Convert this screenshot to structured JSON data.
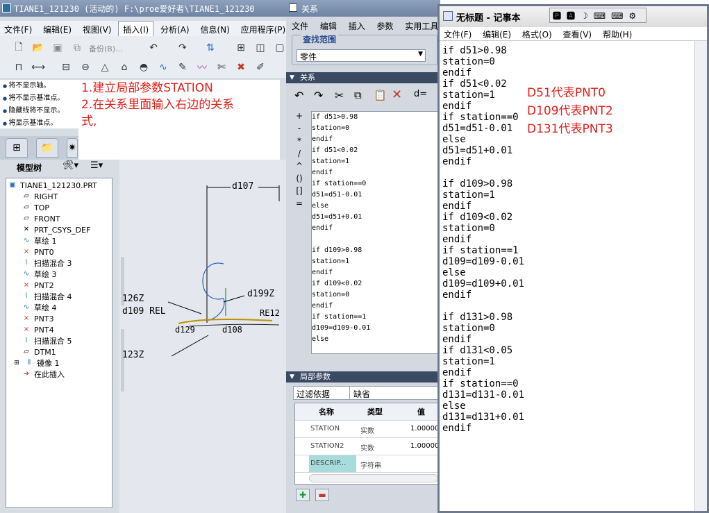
{
  "proe": {
    "title": "TIANE1_121230 (活动的) F:\\proe爱好者\\TIANE1_121230",
    "menu": [
      "文件(F)",
      "编辑(E)",
      "视图(V)",
      "插入(I)",
      "分析(A)",
      "信息(N)",
      "应用程序(P)"
    ],
    "toolbar_backup_label": "备份(B)...",
    "status_lines": [
      "将不显示轴。",
      "将不显示基准点。",
      "隐藏线将不显示。",
      "将显示基准点。"
    ],
    "note_lines": [
      "1.建立局部参数STATION",
      "2.在关系里面输入右边的关系",
      "式,"
    ],
    "model_tree_label": "模型树",
    "tree_items": [
      "TIANE1_121230.PRT",
      "RIGHT",
      "TOP",
      "FRONT",
      "PRT_CSYS_DEF",
      "草绘 1",
      "PNT0",
      "扫描混合 3",
      "草绘 3",
      "PNT2",
      "扫描混合 4",
      "草绘 4",
      "PNT3",
      "PNT4",
      "扫描混合 5",
      "DTM1",
      "镜像 1",
      "在此插入"
    ],
    "dims": {
      "d107": "d107",
      "d126": "126Z",
      "d109": "d109 REL",
      "d199": "d199Z",
      "d123": "123Z",
      "d129": "d129",
      "d108": "d108",
      "rel": "RE12"
    }
  },
  "relations": {
    "title": "关系",
    "menu": [
      "文件",
      "编辑",
      "插入",
      "参数",
      "实用工具"
    ],
    "scope_label": "查找范围",
    "scope_value": "零件",
    "section_relations": "关系",
    "operators": [
      "+",
      "-",
      "*",
      "/",
      "^",
      "()",
      "[]",
      "="
    ],
    "editor_lines": [
      "if d51>0.98",
      "station=0",
      "endif",
      "if d51<0.02",
      "station=1",
      "endif",
      "if station==0",
      "d51=d51-0.01",
      "else",
      "d51=d51+0.01",
      "endif",
      "",
      "if d109>0.98",
      "station=1",
      "endif",
      "if d109<0.02",
      "station=0",
      "endif",
      "if station==1",
      "d109=d109-0.01",
      "else"
    ],
    "section_local_params": "局部参数",
    "filter_label": "过滤依据",
    "filter_value": "缺省",
    "columns": [
      "名称",
      "类型",
      "值"
    ],
    "params": [
      {
        "name": "STATION",
        "type": "实数",
        "value": "1.00000"
      },
      {
        "name": "STATION2",
        "type": "实数",
        "value": "1.00000"
      },
      {
        "name": "DESCRIP...",
        "type": "字符串",
        "value": ""
      }
    ]
  },
  "notepad": {
    "title": "无标题 - 记事本",
    "menu": [
      "文件(F)",
      "编辑(E)",
      "格式(O)",
      "查看(V)",
      "帮助(H)"
    ],
    "lines": [
      "if d51>0.98",
      "station=0",
      "endif",
      "if d51<0.02",
      "station=1",
      "endif",
      "if station==0",
      "d51=d51-0.01",
      "else",
      "d51=d51+0.01",
      "endif",
      "",
      "if d109>0.98",
      "station=1",
      "endif",
      "if d109<0.02",
      "station=0",
      "endif",
      "if station==1",
      "d109=d109-0.01",
      "else",
      "d109=d109+0.01",
      "endif",
      "",
      "if d131>0.98",
      "station=0",
      "endif",
      "if d131<0.05",
      "station=1",
      "endif",
      "if station==0",
      "d131=d131-0.01",
      "else",
      "d131=d131+0.01",
      "endif"
    ],
    "notes": [
      "D51代表PNT0",
      "D109代表PNT2",
      "D131代表PNT3"
    ]
  },
  "colors": {
    "accent_red": "#e0201b",
    "titlebar": "#6f84a3",
    "section_header": "#3b4a63"
  }
}
